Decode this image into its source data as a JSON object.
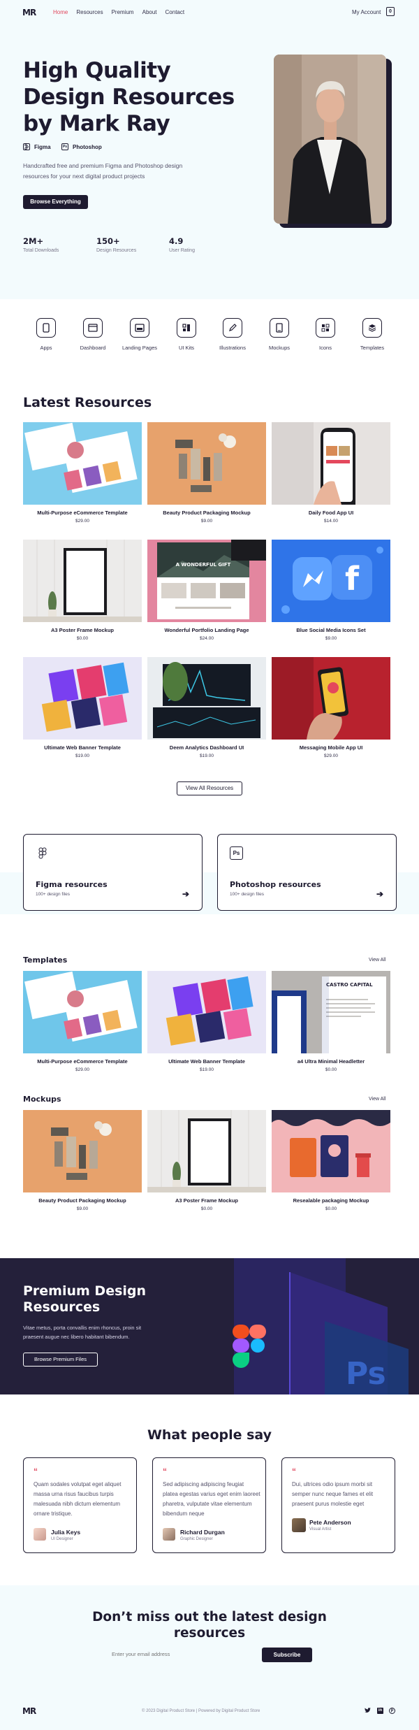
{
  "nav": {
    "logo": "MR",
    "links": [
      "Home",
      "Resources",
      "Premium",
      "About",
      "Contact"
    ],
    "active": "Home",
    "account": "My Account",
    "cart_count": "0"
  },
  "hero": {
    "title": "High Quality Design Resources by Mark Ray",
    "tools": [
      {
        "icon": "figma-icon",
        "label": "Figma"
      },
      {
        "icon": "photoshop-icon",
        "label": "Photoshop"
      }
    ],
    "description": "Handcrafted free and premium Figma and Photoshop design resources for your next digital product projects",
    "cta": "Browse Everything",
    "stats": [
      {
        "value": "2M+",
        "label": "Total Downloads"
      },
      {
        "value": "150+",
        "label": "Design Resources"
      },
      {
        "value": "4.9",
        "label": "User Rating"
      }
    ]
  },
  "categories": [
    {
      "icon": "apps-icon",
      "label": "Apps"
    },
    {
      "icon": "dashboard-icon",
      "label": "Dashboard"
    },
    {
      "icon": "landing-pages-icon",
      "label": "Landing Pages"
    },
    {
      "icon": "ui-kits-icon",
      "label": "UI Kits"
    },
    {
      "icon": "illustrations-icon",
      "label": "Illustrations"
    },
    {
      "icon": "mockups-icon",
      "label": "Mockups"
    },
    {
      "icon": "icons-icon",
      "label": "Icons"
    },
    {
      "icon": "templates-icon",
      "label": "Templates"
    }
  ],
  "latest": {
    "title": "Latest Resources",
    "items": [
      {
        "title": "Multi-Purpose eCommerce Template",
        "price": "$29.00"
      },
      {
        "title": "Beauty Product Packaging Mockup",
        "price": "$9.00"
      },
      {
        "title": "Daily Food App UI",
        "price": "$14.00"
      },
      {
        "title": "A3 Poster Frame Mockup",
        "price": "$0.00"
      },
      {
        "title": "Wonderful Portfolio Landing Page",
        "price": "$24.00"
      },
      {
        "title": "Blue Social Media Icons Set",
        "price": "$9.00"
      },
      {
        "title": "Ultimate Web Banner Template",
        "price": "$19.00"
      },
      {
        "title": "Deem Analytics Dashboard UI",
        "price": "$19.00"
      },
      {
        "title": "Messaging Mobile App UI",
        "price": "$29.00"
      }
    ],
    "view_all": "View All Resources",
    "image_text": {
      "portfolio_banner": "A WONDERFUL GIFT"
    }
  },
  "resource_cards": [
    {
      "icon": "figma-icon",
      "title": "Figma resources",
      "subtitle": "100+ design files"
    },
    {
      "icon": "photoshop-icon",
      "icon_text": "Ps",
      "title": "Photoshop resources",
      "subtitle": "100+ design files"
    }
  ],
  "templates": {
    "title": "Templates",
    "view_all": "View All",
    "items": [
      {
        "title": "Multi-Purpose eCommerce Template",
        "price": "$29.00"
      },
      {
        "title": "Ultimate Web Banner Template",
        "price": "$19.00"
      },
      {
        "title": "a4 Ultra Minimal Headletter",
        "price": "$0.00"
      }
    ],
    "image_text": {
      "letterhead": "CASTRO CAPITAL"
    }
  },
  "mockups": {
    "title": "Mockups",
    "view_all": "View All",
    "items": [
      {
        "title": "Beauty Product Packaging Mockup",
        "price": "$9.00"
      },
      {
        "title": "A3 Poster Frame Mockup",
        "price": "$0.00"
      },
      {
        "title": "Resealable packaging Mockup",
        "price": "$0.00"
      }
    ]
  },
  "premium": {
    "title": "Premium Design Resources",
    "description": "Vitae metus, porta convallis enim rhoncus, proin sit praesent augue nec libero habitant bibendum.",
    "cta": "Browse Premium Files",
    "image_text": {
      "ps_logo": "Ps"
    }
  },
  "testimonials": {
    "title": "What people say",
    "quote_mark": "“",
    "items": [
      {
        "text": "Quam sodales volutpat eget aliquet massa urna risus faucibus turpis malesuada nibh dictum elementum ornare tristique.",
        "name": "Julia Keys",
        "role": "UI Designer"
      },
      {
        "text": "Sed adipiscing adipiscing feugiat platea egestas varius eget enim laoreet pharetra, vulputate vitae elementum bibendum neque",
        "name": "Richard Durgan",
        "role": "Graphic Designer"
      },
      {
        "text": "Dui, ultrices odio ipsum morbi sit semper nunc neque fames et elit praesent purus molestie eget",
        "name": "Pete Anderson",
        "role": "Visual Artist"
      }
    ]
  },
  "newsletter": {
    "title": "Don’t miss out the latest design resources",
    "placeholder": "Enter your email address",
    "cta": "Subscribe"
  },
  "footer": {
    "logo": "MR",
    "copyright": "© 2023 Digital Product Store | Powered by Digital Product Store",
    "social": [
      {
        "icon": "twitter-icon",
        "glyph": "🐦"
      },
      {
        "icon": "linkedin-icon",
        "glyph": "in"
      },
      {
        "icon": "pinterest-icon",
        "glyph": "℗"
      }
    ]
  },
  "colors": {
    "dark": "#1e1b30",
    "accent": "#e0465c",
    "light_bg": "#f3fbfd",
    "premium_bg": "#24203a"
  }
}
